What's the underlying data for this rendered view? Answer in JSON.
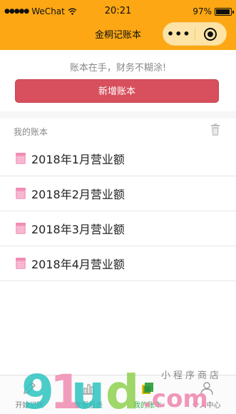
{
  "status_bar": {
    "carrier": "WeChat",
    "time": "20:21",
    "battery": "97%",
    "battery_level": 0.97
  },
  "nav": {
    "title": "金桐记账本"
  },
  "slogan": "账本在手，财务不糊涂!",
  "new_button_label": "新增账本",
  "section_title": "我的账本",
  "ledgers": [
    {
      "name": "2018年1月营业额"
    },
    {
      "name": "2018年2月营业额"
    },
    {
      "name": "2018年3月营业额"
    },
    {
      "name": "2018年4月营业额"
    }
  ],
  "tabbar": {
    "tabs": [
      {
        "label": "开始记账",
        "icon": "pen-icon"
      },
      {
        "label": "数据报表",
        "icon": "chart-icon"
      },
      {
        "label": "我的账本",
        "icon": "book-icon"
      },
      {
        "label": "个人中心",
        "icon": "user-icon"
      }
    ]
  },
  "watermark": {
    "main": "91ud.com",
    "sub": "小程序商店"
  },
  "colors": {
    "header": "#fca713",
    "primary_button": "#d84f5e",
    "active_tab": "#3aa54a",
    "book_icon": "#f08cb3"
  }
}
